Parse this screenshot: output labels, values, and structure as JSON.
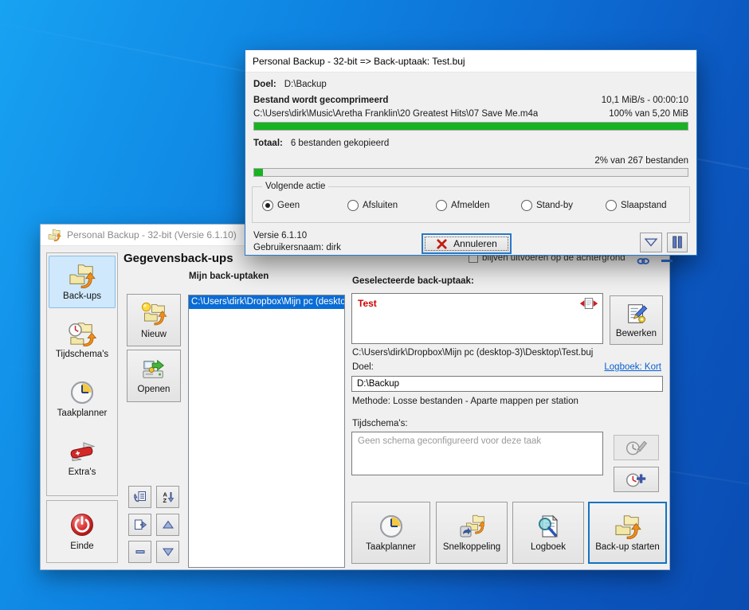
{
  "progress_dialog": {
    "title": "Personal Backup - 32-bit => Back-uptaak: Test.buj",
    "doel_label": "Doel:",
    "doel_value": "D:\\Backup",
    "status": "Bestand wordt gecomprimeerd",
    "speed": "10,1 MiB/s - 00:00:10",
    "file": "C:\\Users\\dirk\\Music\\Aretha Franklin\\20 Greatest Hits\\07 Save Me.m4a",
    "file_pct_text": "100% van 5,20 MiB",
    "file_pct": 100,
    "total_label": "Totaal:",
    "total_value": "6 bestanden gekopieerd",
    "total_pct_text": "2% van 267 bestanden",
    "total_pct": 2,
    "group_label": "Volgende actie",
    "radios": [
      {
        "label": "Geen",
        "selected": true
      },
      {
        "label": "Afsluiten",
        "selected": false
      },
      {
        "label": "Afmelden",
        "selected": false
      },
      {
        "label": "Stand-by",
        "selected": false
      },
      {
        "label": "Slaapstand",
        "selected": false
      }
    ],
    "version": "Versie 6.1.10",
    "user": "Gebruikersnaam: dirk",
    "cancel": "Annuleren"
  },
  "main_window": {
    "title": "Personal Backup - 32-bit (Versie 6.1.10)",
    "header": "Gegevensback-ups",
    "bg_checkbox": "blijven uitvoeren op de achtergrond",
    "sidebar": {
      "items": [
        {
          "label": "Back-ups",
          "selected": true
        },
        {
          "label": "Tijdschema's",
          "selected": false
        },
        {
          "label": "Taakplanner",
          "selected": false
        },
        {
          "label": "Extra's",
          "selected": false
        }
      ],
      "einde": "Einde"
    },
    "tasks": {
      "label": "Mijn back-uptaken",
      "items": [
        "C:\\Users\\dirk\\Dropbox\\Mijn pc (deskto"
      ]
    },
    "nieuw": "Nieuw",
    "openen": "Openen",
    "selected_task": {
      "label": "Geselecteerde back-uptaak:",
      "name": "Test",
      "path": "C:\\Users\\dirk\\Dropbox\\Mijn pc (desktop-3)\\Desktop\\Test.buj",
      "doel_label": "Doel:",
      "logbook_link": "Logboek: Kort",
      "doel_value": "D:\\Backup",
      "methode": "Methode: Losse bestanden - Aparte mappen per station",
      "schedules_label": "Tijdschema's:",
      "schedules_empty": "Geen schema geconfigureerd voor deze taak",
      "bewerken": "Bewerken"
    },
    "bottom_buttons": [
      "Taakplanner",
      "Snelkoppeling",
      "Logboek",
      "Back-up starten"
    ]
  },
  "colors": {
    "accent_blue": "#0a6cd6",
    "progress_green": "#17b322",
    "task_name_red": "#cc0000",
    "desktop_blue": "#0d6ed4"
  },
  "icons": {
    "app": "backup-folders-arrow",
    "cancel": "red-x",
    "pause": "pause-bars",
    "dropdown": "triangle-down",
    "einde": "red-power",
    "extras": "swiss-knife",
    "taakplanner": "clock",
    "logboek": "magnifier-document"
  }
}
